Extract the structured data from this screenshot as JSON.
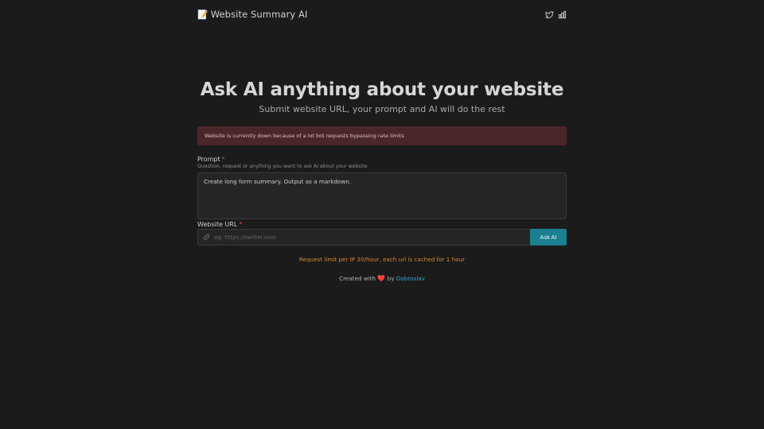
{
  "header": {
    "brand_icon": "memo-icon",
    "brand_emoji": "📝",
    "brand_name": "Website Summary AI",
    "icons": [
      "twitter-icon",
      "bar-chart-icon"
    ]
  },
  "hero": {
    "title": "Ask AI anything about your website",
    "subtitle": "Submit website URL, your prompt and AI will do the rest"
  },
  "alert": {
    "text": "Website is currently down because of a lot bot requests bypassing rate limits"
  },
  "form": {
    "prompt": {
      "label": "Prompt",
      "required_mark": "*",
      "help": "Question, request or anything you want to ask AI about your website",
      "value": "Create long form summary. Output as a markdown."
    },
    "url": {
      "label": "Website URL",
      "required_mark": "*",
      "placeholder": "eg. https://twitter.com",
      "value": "",
      "icon": "link-icon"
    },
    "submit_label": "Ask AI"
  },
  "limit_note": "Request limit per IP 30/hour, each url is cached for 1 hour",
  "footer": {
    "prefix": "Created with",
    "heart": "❤️",
    "by": "by",
    "author": "Dobroslav"
  },
  "colors": {
    "background": "#1b1b1c",
    "accent": "#1a7f8f",
    "alert_bg": "#4a2628",
    "note": "#d9862c",
    "link": "#3ea3c9"
  }
}
